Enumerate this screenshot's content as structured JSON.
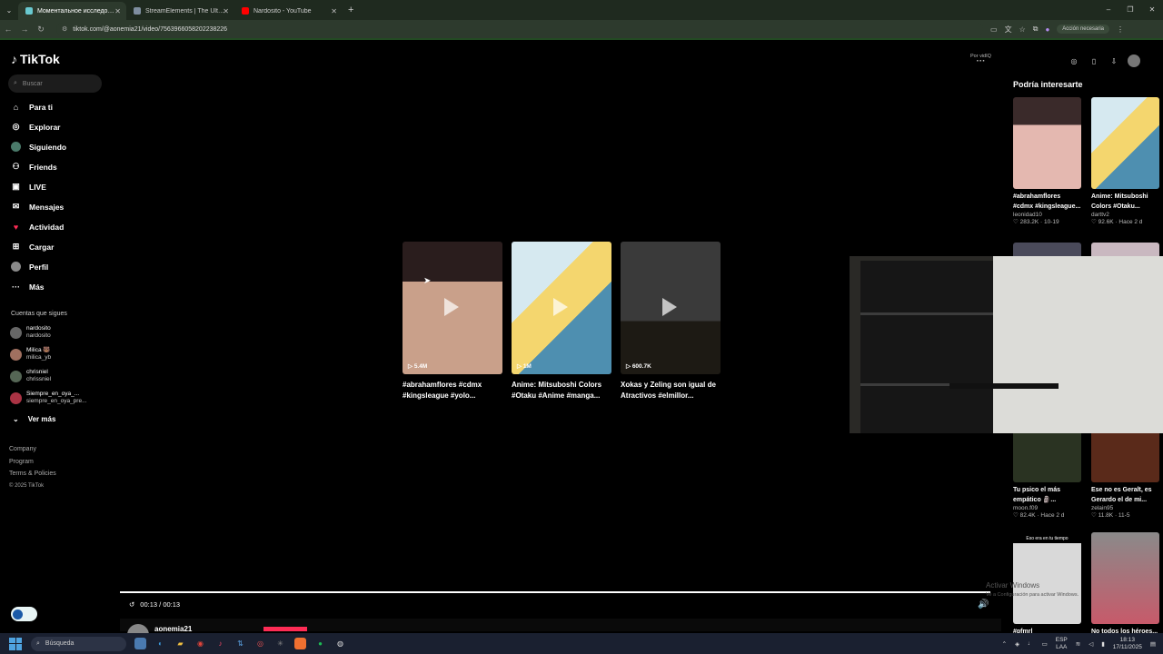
{
  "browser": {
    "tabs": [
      {
        "label": "Моментальное исследование",
        "color": "#69c9d0",
        "active": true
      },
      {
        "label": "StreamElements | The Ultimate",
        "color": "#7f8ea0",
        "active": false
      },
      {
        "label": "Nardosito - YouTube",
        "color": "#ff0000",
        "active": false
      }
    ],
    "new_tab": "+",
    "url": "tiktok.com/@aonemia21/video/7563966058202238226",
    "action_label": "Acción necesaria"
  },
  "tiktok": {
    "brand": "TikTok",
    "search_placeholder": "Buscar",
    "nav": [
      {
        "label": "Para ti",
        "icon": "home-icon"
      },
      {
        "label": "Explorar",
        "icon": "compass-icon"
      },
      {
        "label": "Siguiendo",
        "icon": "following-avatar-icon"
      },
      {
        "label": "Friends",
        "icon": "friends-icon"
      },
      {
        "label": "LIVE",
        "icon": "live-icon"
      },
      {
        "label": "Mensajes",
        "icon": "message-icon"
      },
      {
        "label": "Actividad",
        "icon": "activity-icon"
      },
      {
        "label": "Cargar",
        "icon": "upload-icon"
      },
      {
        "label": "Perfil",
        "icon": "profile-icon"
      },
      {
        "label": "Más",
        "icon": "more-icon"
      }
    ],
    "following_title": "Cuentas que sigues",
    "following": [
      {
        "name": "nardosito",
        "user": "nardosito"
      },
      {
        "name": "Milica 🐻",
        "user": "milica_yb"
      },
      {
        "name": "chrisniel",
        "user": "chrissniel"
      },
      {
        "name": "Siempre_en_oya_...",
        "user": "siempre_en_oya_pre..."
      }
    ],
    "see_more": "Ver más",
    "footer": [
      "Company",
      "Program",
      "Terms & Policies"
    ],
    "copyright": "© 2025 TikTok",
    "por_vidiq": "Por vidIQ"
  },
  "recommended": [
    {
      "views": "5.4M",
      "title": "#abrahamflores #cdmx #kingsleague #yolo..."
    },
    {
      "views": "1M",
      "title": "Anime: Mitsuboshi Colors #Otaku #Anime #manga..."
    },
    {
      "views": "600.7K",
      "title": "Xokas y Zeling son igual de Atractivos #elmillor..."
    }
  ],
  "player": {
    "time": "00:13 / 00:13",
    "author": "aonemia21"
  },
  "right_panel": {
    "title": "Podría interesarte",
    "cards": [
      {
        "text": "#abrahamflores #cdmx #kingsleague...",
        "user": "leonidad10",
        "stats": "♡ 283.2K · 10-19"
      },
      {
        "text": "Anime: Mitsuboshi Colors #Otaku...",
        "user": "darttv2",
        "stats": "♡ 92.6K · Hace 2 d"
      },
      {
        "text": "Tu psico el más empático 🗿...",
        "user": "moon.f09",
        "stats": "♡ 82.4K · Hace 2 d"
      },
      {
        "text": "Ese no es Geralt, es Gerardo el de mi...",
        "user": "zelain95",
        "stats": "♡ 11.8K · 11-5"
      },
      {
        "text": "#pfmrl",
        "user": "",
        "stats": ""
      },
      {
        "text": "No todos los héroes...",
        "user": "",
        "stats": ""
      }
    ],
    "thumb_caption": "Eso era en tu tiempo",
    "watermark_line1": "Activar Windows",
    "watermark_line2": "Ve a Configuración para activar Windows."
  },
  "taskbar": {
    "search": "Búsqueda",
    "lang": "ESP",
    "region": "LAA",
    "time": "18:13",
    "date": "17/11/2025"
  }
}
